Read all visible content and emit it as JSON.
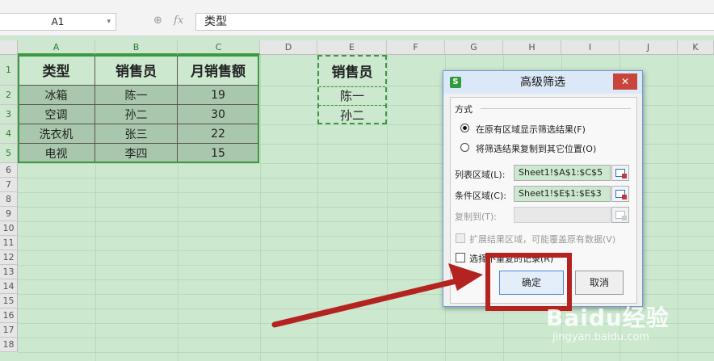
{
  "formula_bar": {
    "cell_ref": "A1",
    "fx_label": "fx",
    "content": "类型"
  },
  "columns": [
    "A",
    "B",
    "C",
    "D",
    "E",
    "F",
    "G",
    "H",
    "I",
    "J",
    "K"
  ],
  "rows": [
    "1",
    "2",
    "3",
    "4",
    "5",
    "6",
    "7",
    "8",
    "9",
    "10",
    "11",
    "12",
    "13",
    "14",
    "15",
    "16",
    "17",
    "18"
  ],
  "data_table": {
    "headers": [
      "类型",
      "销售员",
      "月销售额"
    ],
    "rows": [
      [
        "冰箱",
        "陈一",
        "19"
      ],
      [
        "空调",
        "孙二",
        "30"
      ],
      [
        "洗衣机",
        "张三",
        "22"
      ],
      [
        "电视",
        "李四",
        "15"
      ]
    ]
  },
  "criteria": {
    "header": "销售员",
    "values": [
      "陈一",
      "孙二"
    ]
  },
  "dialog": {
    "app_icon": "S",
    "title": "高级筛选",
    "close_label": "✕",
    "section_label": "方式",
    "option_inplace": "在原有区域显示筛选结果(F)",
    "option_copy": "将筛选结果复制到其它位置(O)",
    "list_range_label": "列表区域(L):",
    "list_range_value": "Sheet1!$A$1:$C$5",
    "criteria_range_label": "条件区域(C):",
    "criteria_range_value": "Sheet1!$E$1:$E$3",
    "copy_to_label": "复制到(T):",
    "copy_to_value": "",
    "expand_label": "扩展结果区域，可能覆盖原有数据(V)",
    "unique_label": "选择不重复的记录(R)",
    "ok_label": "确定",
    "cancel_label": "取消"
  },
  "watermark": {
    "brand": "Baidu经验",
    "url": "jingyan.baidu.com"
  },
  "colors": {
    "sheet_bg": "#cce8cf",
    "table_fill": "#a9c7ad",
    "selection_green": "#3a9a40",
    "annotation_red": "#b4231f"
  },
  "icons": [
    "dropdown-icon",
    "zoom-icon",
    "fx-icon",
    "app-icon",
    "close-icon",
    "range-picker-icon",
    "arrow-annotation"
  ]
}
